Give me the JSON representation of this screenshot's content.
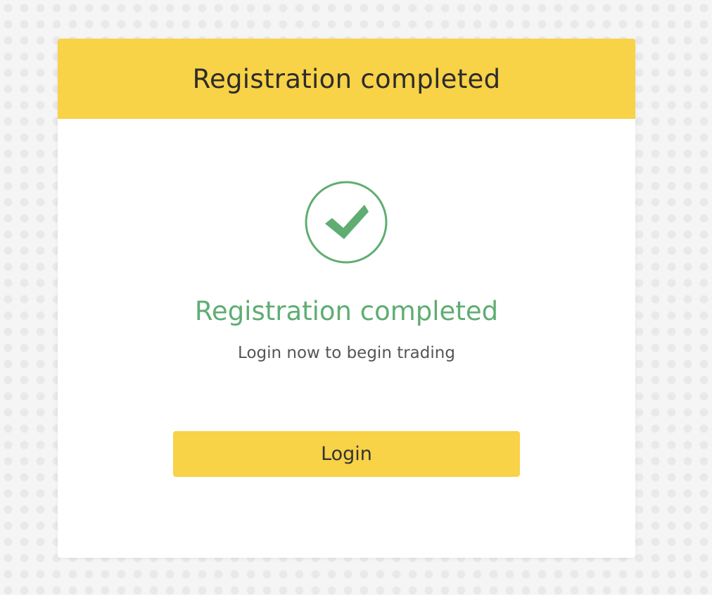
{
  "header": {
    "title": "Registration completed"
  },
  "status": {
    "icon": "check-circle-icon",
    "heading": "Registration completed",
    "subtitle": "Login now to begin trading"
  },
  "actions": {
    "login_label": "Login"
  },
  "colors": {
    "accent": "#f8d247",
    "success": "#5fad72",
    "background": "#f5f5f5"
  }
}
